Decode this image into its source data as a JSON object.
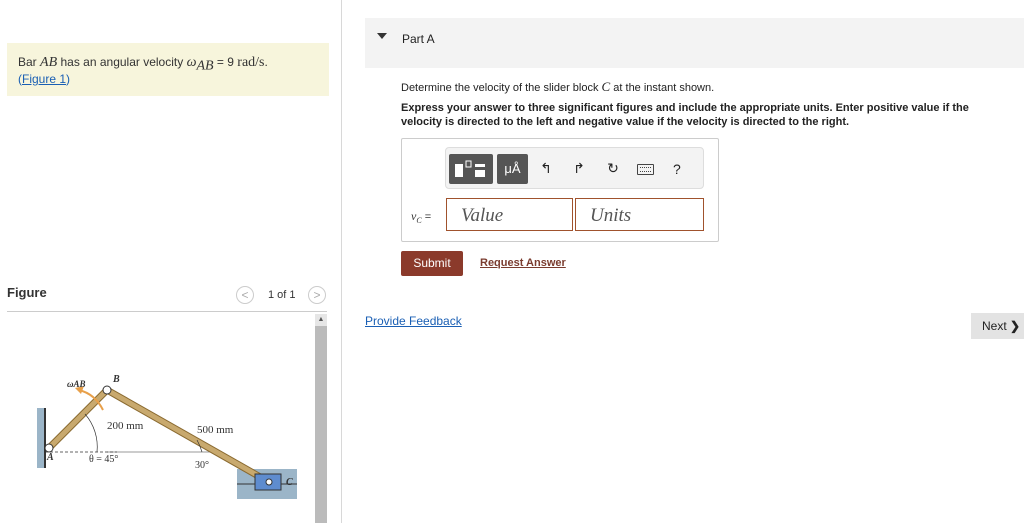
{
  "problem": {
    "intro": "Bar",
    "bar": "AB",
    "mid": "has an angular velocity",
    "omega": "ω",
    "omega_sub": "AB",
    "equals": "= 9",
    "unit": "rad/s",
    "end": ".",
    "figure_link": "Figure 1"
  },
  "figure": {
    "title": "Figure",
    "pager": "1 of 1",
    "prev": "<",
    "next": ">",
    "labels": {
      "omega": "ωAB",
      "b": "B",
      "a": "A",
      "c": "C",
      "len_ab": "200 mm",
      "len_bc": "500 mm",
      "theta": "θ = 45°",
      "angle": "30°"
    }
  },
  "part": {
    "title": "Part A",
    "question_pre": "Determine the velocity of the slider block",
    "question_var": "C",
    "question_post": "at the instant shown.",
    "instructions": "Express your answer to three significant figures and include the appropriate units. Enter positive value if the velocity is directed to the left and negative value if the velocity is directed to the right.",
    "variable": "vC",
    "variable_base": "v",
    "variable_sub": "C",
    "variable_eq": "=",
    "value_placeholder": "Value",
    "units_placeholder": "Units",
    "toolbar": {
      "templates_icon": "templates-icon",
      "units_label": "μÅ",
      "undo_icon": "undo-icon",
      "redo_icon": "redo-icon",
      "reset_icon": "reset-icon",
      "keyboard_icon": "keyboard-icon",
      "help": "?"
    },
    "submit": "Submit",
    "request_answer": "Request Answer"
  },
  "footer": {
    "feedback": "Provide Feedback",
    "next": "Next"
  },
  "colors": {
    "problem_bg": "#f7f5dc",
    "submit": "#8b3a2b",
    "link": "#1a5fb4",
    "bar": "#c8a96e"
  }
}
